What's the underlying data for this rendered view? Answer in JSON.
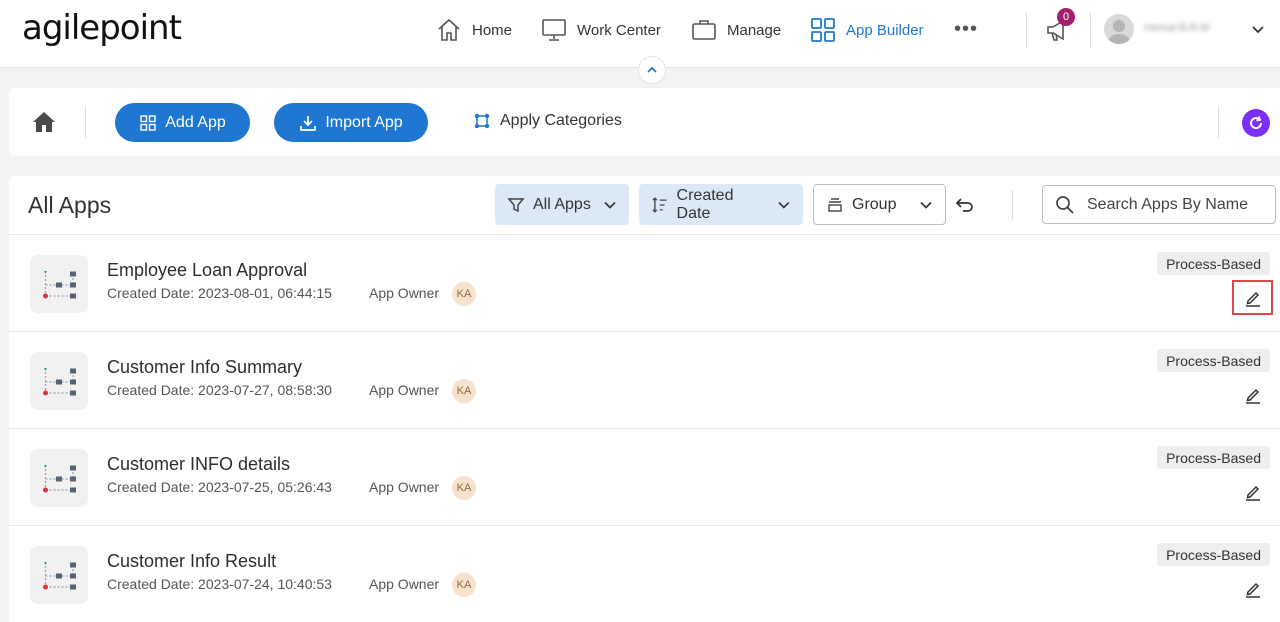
{
  "brand": {
    "logo_text": "agilepoint",
    "accent": "#1f77d2"
  },
  "nav": {
    "items": [
      {
        "label": "Home",
        "icon": "home-icon"
      },
      {
        "label": "Work Center",
        "icon": "monitor-icon"
      },
      {
        "label": "Manage",
        "icon": "briefcase-icon"
      },
      {
        "label": "App Builder",
        "icon": "grid-icon",
        "active": true
      }
    ],
    "more_label": "•••",
    "notifications_count": "0",
    "user_name": "Hemal B.R.M"
  },
  "toolbar": {
    "add_app_label": "Add App",
    "import_app_label": "Import App",
    "apply_categories_label": "Apply Categories"
  },
  "main": {
    "title": "All Apps",
    "filters": {
      "all_apps_label": "All Apps",
      "sort_label": "Created Date",
      "group_label": "Group"
    },
    "search_placeholder": "Search Apps By Name",
    "owner_label": "App Owner",
    "apps": [
      {
        "name": "Employee Loan Approval",
        "created": "Created Date: 2023-08-01, 06:44:15",
        "owner_initials": "KA",
        "type": "Process-Based",
        "edit_highlighted": true
      },
      {
        "name": "Customer Info Summary",
        "created": "Created Date: 2023-07-27, 08:58:30",
        "owner_initials": "KA",
        "type": "Process-Based"
      },
      {
        "name": "Customer INFO details",
        "created": "Created Date: 2023-07-25, 05:26:43",
        "owner_initials": "KA",
        "type": "Process-Based"
      },
      {
        "name": "Customer Info Result",
        "created": "Created Date: 2023-07-24, 10:40:53",
        "owner_initials": "KA",
        "type": "Process-Based"
      }
    ]
  }
}
